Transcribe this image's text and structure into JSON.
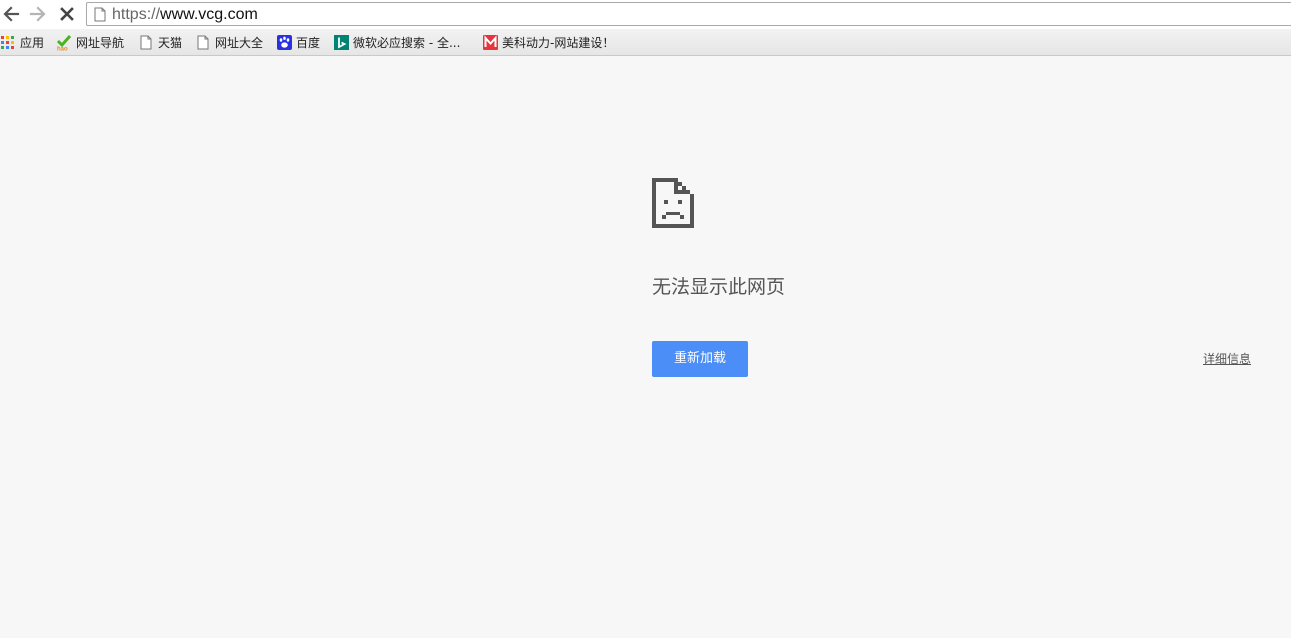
{
  "toolbar": {
    "url_scheme": "https://",
    "url_host": "www.vcg.com"
  },
  "bookmarks": {
    "items": [
      {
        "label": "应用",
        "icon": "apps-grid-icon"
      },
      {
        "label": "网址导航",
        "icon": "hao123-icon"
      },
      {
        "label": "天猫",
        "icon": "page-icon"
      },
      {
        "label": "网址大全",
        "icon": "page-icon"
      },
      {
        "label": "百度",
        "icon": "baidu-paw-icon"
      },
      {
        "label": "微软必应搜索 - 全...",
        "icon": "bing-icon"
      },
      {
        "label": "美科动力-网站建设！",
        "icon": "m-logo-icon"
      }
    ]
  },
  "error_page": {
    "icon": "sad-document-icon",
    "title": "无法显示此网页",
    "reload_label": "重新加载",
    "details_label": "详细信息"
  },
  "colors": {
    "page_background": "#f7f7f7",
    "button_blue": "#4c8ef7",
    "title_gray": "#555555"
  }
}
